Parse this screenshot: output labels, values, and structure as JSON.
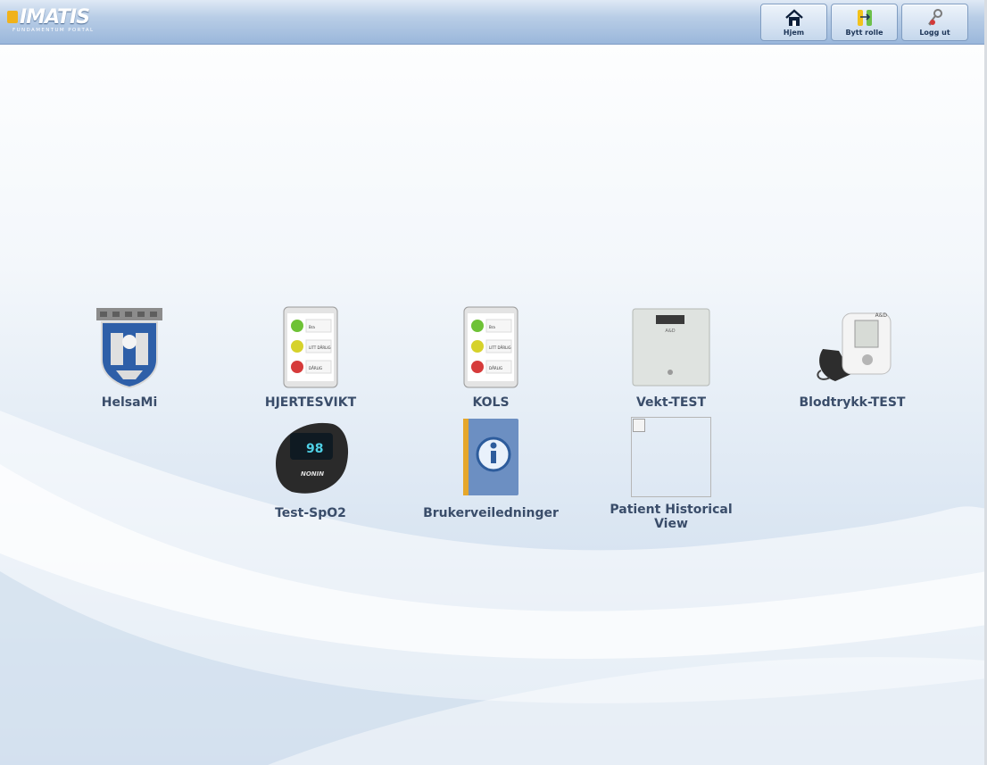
{
  "header": {
    "logo": {
      "wordmark": "IMATIS",
      "tagline": "FUNDAMENTUM PORTAL"
    },
    "buttons": [
      {
        "label": "Hjem",
        "icon": "home-icon"
      },
      {
        "label": "Bytt rolle",
        "icon": "switch-role-icon"
      },
      {
        "label": "Logg ut",
        "icon": "logout-keys-icon"
      }
    ]
  },
  "apps": [
    {
      "label": "HelsaMi",
      "icon": "coat-of-arms-icon"
    },
    {
      "label": "HJERTESVIKT",
      "icon": "tablet-smiley-icon"
    },
    {
      "label": "KOLS",
      "icon": "tablet-smiley-icon"
    },
    {
      "label": "Vekt-TEST",
      "icon": "bathroom-scale-icon"
    },
    {
      "label": "Blodtrykk-TEST",
      "icon": "blood-pressure-monitor-icon"
    },
    {
      "label": "Test-SpO2",
      "icon": "pulse-oximeter-icon"
    },
    {
      "label": "Brukerveiledninger",
      "icon": "info-book-icon"
    },
    {
      "label": "Patient Historical View",
      "icon": "broken-image-icon"
    }
  ],
  "device_text": {
    "oximeter_reading": "98",
    "oximeter_brand": "NONIN",
    "scale_brand": "A&D",
    "bp_brand": "A&D",
    "smiley_labels": [
      "Bra",
      "LITT DÅRLIG",
      "DÅRLIG"
    ]
  },
  "colors": {
    "header_top": "#dfe9f5",
    "header_bottom": "#9ab7db",
    "label_text": "#3a4d6a",
    "logo_accent": "#f0b21b"
  }
}
